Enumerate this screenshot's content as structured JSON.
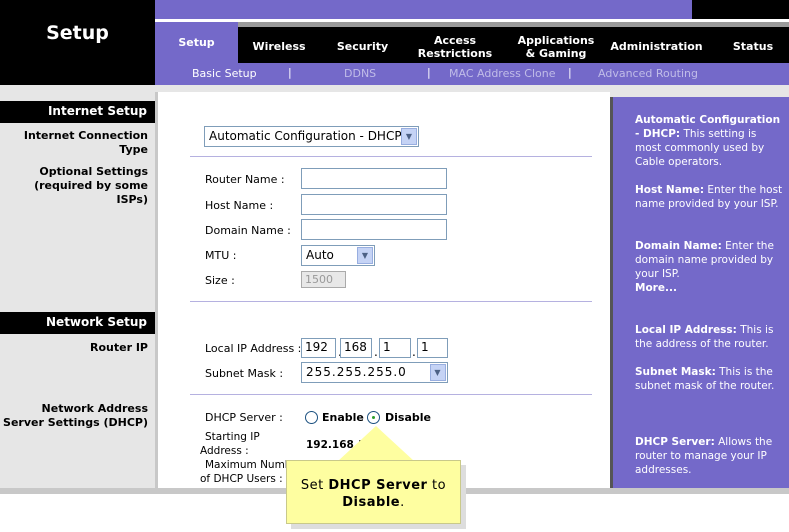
{
  "header": {
    "title": "Setup"
  },
  "tabs": [
    {
      "label": "Setup",
      "active": true
    },
    {
      "label": "Wireless"
    },
    {
      "label": "Security"
    },
    {
      "label": "Access Restrictions"
    },
    {
      "label": "Applications & Gaming"
    },
    {
      "label": "Administration"
    },
    {
      "label": "Status"
    }
  ],
  "subnav": [
    {
      "label": "Basic Setup",
      "active": true
    },
    {
      "label": "DDNS"
    },
    {
      "label": "MAC Address Clone"
    },
    {
      "label": "Advanced Routing"
    }
  ],
  "sections": {
    "internet_setup": "Internet Setup",
    "network_setup": "Network Setup"
  },
  "labels": {
    "connection_type": "Internet Connection Type",
    "optional_1": "Optional Settings",
    "optional_2": "(required by some ISPs)",
    "router_ip": "Router IP",
    "dhcp_1": "Network Address",
    "dhcp_2": "Server Settings (DHCP)"
  },
  "form": {
    "connection_type": "Automatic Configuration - DHCP",
    "router_name_label": "Router Name :",
    "router_name": "",
    "host_name_label": "Host Name :",
    "host_name": "",
    "domain_name_label": "Domain Name :",
    "domain_name": "",
    "mtu_label": "MTU :",
    "mtu": "Auto",
    "size_label": "Size :",
    "size": "1500",
    "local_ip_label": "Local IP Address :",
    "local_ip": [
      "192",
      "168",
      "1",
      "1"
    ],
    "subnet_label": "Subnet Mask :",
    "subnet": "255.255.255.0",
    "dhcp_label": "DHCP Server :",
    "enable": "Enable",
    "disable": "Disable",
    "dhcp_value": "Disable",
    "start_ip_label_1": "Starting IP",
    "start_ip_label_2": "Address :",
    "start_ip": "192.168.1.",
    "max_users_label_1": "Maximum Number",
    "max_users_label_2": "of  DHCP Users :"
  },
  "help": [
    {
      "title": "Automatic Configuration - DHCP:",
      "text": " This setting is most commonly used by Cable operators."
    },
    {
      "title": "Host Name:",
      "text": " Enter the host name provided by your ISP."
    },
    {
      "title": "Domain Name:",
      "text": " Enter the domain name provided by your ISP."
    },
    {
      "more": "More..."
    },
    {
      "title": "Local IP Address:",
      "text": " This is the address of the router."
    },
    {
      "title": "Subnet Mask:",
      "text": " This is the subnet mask of the router."
    },
    {
      "title": "DHCP Server:",
      "text": " Allows the router to manage your IP addresses."
    }
  ],
  "callout": {
    "pre": "Set ",
    "bold1": "DHCP Server",
    "mid": " to ",
    "bold2": "Disable",
    "post": "."
  },
  "colors": {
    "brand_purple": "#7469c9",
    "callout": "#fefea0"
  }
}
